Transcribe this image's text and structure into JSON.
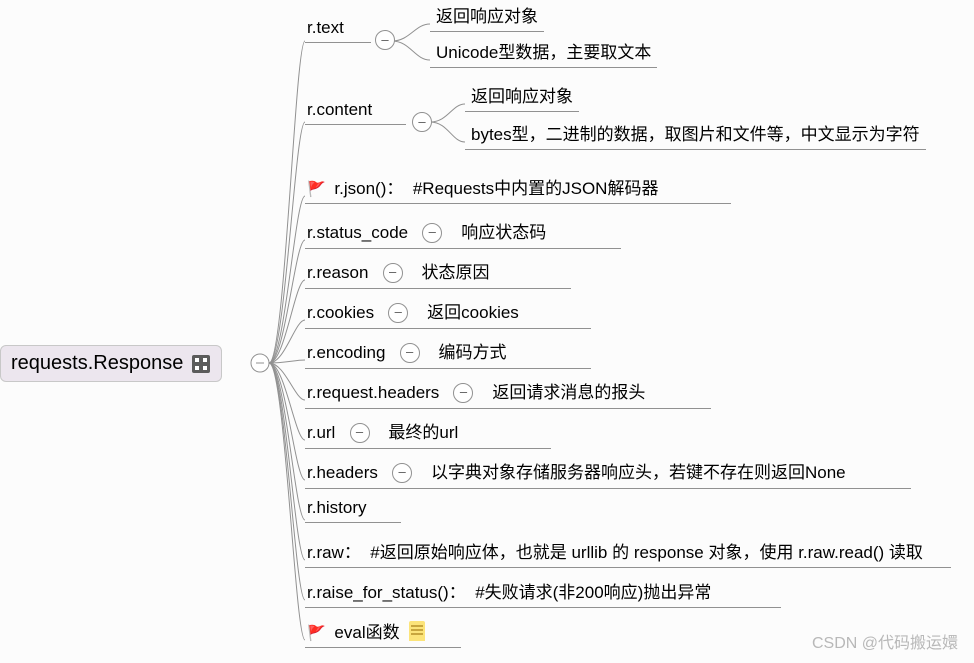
{
  "root": {
    "label": "requests.Response"
  },
  "items": [
    {
      "label": "r.text",
      "children": [
        {
          "label": "返回响应对象"
        },
        {
          "label": "Unicode型数据，主要取文本"
        }
      ]
    },
    {
      "label": "r.content",
      "children": [
        {
          "label": "返回响应对象"
        },
        {
          "label": "bytes型，二进制的数据，取图片和文件等，中文显示为字符"
        }
      ]
    },
    {
      "flag": true,
      "label": "r.json()：",
      "note": "#Requests中内置的JSON解码器"
    },
    {
      "label": "r.status_code",
      "child": "响应状态码"
    },
    {
      "label": "r.reason",
      "child": "状态原因"
    },
    {
      "label": "r.cookies",
      "child": "返回cookies"
    },
    {
      "label": "r.encoding",
      "child": "编码方式"
    },
    {
      "label": "r.request.headers",
      "child": "返回请求消息的报头"
    },
    {
      "label": "r.url",
      "child": "最终的url"
    },
    {
      "label": "r.headers",
      "child": "以字典对象存储服务器响应头，若键不存在则返回None"
    },
    {
      "label": "r.history"
    },
    {
      "label": "r.raw：",
      "note": "#返回原始响应体，也就是 urllib 的 response 对象，使用 r.raw.read() 读取"
    },
    {
      "label": "r.raise_for_status()：",
      "note": "#失败请求(非200响应)抛出异常"
    },
    {
      "flag": true,
      "label": "eval函数",
      "icon": "note"
    }
  ],
  "watermark": "CSDN @代码搬运嬛"
}
